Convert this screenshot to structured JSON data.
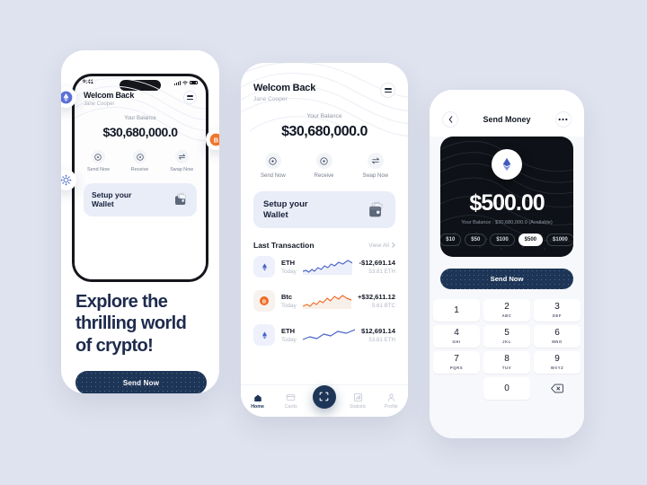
{
  "background_color": "#dfe3ef",
  "accent_navy": "#1d3557",
  "accent_blue": "#5a6fd8",
  "accent_orange": "#f0762a",
  "phone1": {
    "status_bar": {
      "time": "9:41"
    },
    "header": {
      "greeting": "Welcom Back",
      "name": "Jane Cooper",
      "menu_icon": "hamburger-icon"
    },
    "balance": {
      "label": "Your Balance",
      "amount": "$30,680,000.0"
    },
    "actions": [
      {
        "label": "Send Now",
        "icon": "send-icon"
      },
      {
        "label": "Receive",
        "icon": "receive-icon"
      },
      {
        "label": "Swap Now",
        "icon": "swap-icon"
      }
    ],
    "setup_card": {
      "line1": "Setup your",
      "line2": "Wallet",
      "icon": "wallet-icon"
    },
    "floating_icons": [
      {
        "name": "ethereum-badge",
        "symbol": "ETH",
        "color": "#5a6fd8"
      },
      {
        "name": "bitcoin-badge",
        "symbol": "BTC",
        "color": "#f0762a"
      },
      {
        "name": "network-badge",
        "symbol": "NET",
        "color": "#3f62c9"
      }
    ],
    "hero": {
      "line1": "Explore the",
      "line2": "thrilling world",
      "line3": "of crypto!"
    },
    "cta": {
      "label": "Send Now"
    }
  },
  "phone2": {
    "header": {
      "greeting": "Welcom Back",
      "name": "Jane Cooper",
      "menu_icon": "hamburger-icon"
    },
    "balance": {
      "label": "Your Balance",
      "amount": "$30,680,000.0"
    },
    "actions": [
      {
        "label": "Send Now",
        "icon": "send-icon"
      },
      {
        "label": "Receive",
        "icon": "receive-icon"
      },
      {
        "label": "Swap Now",
        "icon": "swap-icon"
      }
    ],
    "setup_card": {
      "line1": "Setup your",
      "line2": "Wallet",
      "icon": "wallet-icon"
    },
    "transactions_section": {
      "title": "Last Transaction",
      "view_all": "View All",
      "chevron": "chevron-right-icon"
    },
    "transactions": [
      {
        "symbol": "ETH",
        "icon": "ethereum-icon",
        "when": "Today",
        "amount": "-$12,691.14",
        "quantity": "53.81 ETH",
        "trend_color": "#4a63c9"
      },
      {
        "symbol": "Btc",
        "icon": "bitcoin-icon",
        "when": "Today",
        "amount": "+$32,611.12",
        "quantity": "5.61 BTC",
        "trend_color": "#ef6a23"
      },
      {
        "symbol": "ETH",
        "icon": "ethereum-icon",
        "when": "Today",
        "amount": "$12,691.14",
        "quantity": "53.81 ETH",
        "trend_color": "#4a63c9"
      }
    ],
    "tabs": [
      {
        "label": "Home",
        "icon": "home-icon",
        "active": true
      },
      {
        "label": "Cards",
        "icon": "card-icon",
        "active": false
      },
      {
        "label": "",
        "icon": "scan-icon",
        "active": false
      },
      {
        "label": "Statistic",
        "icon": "chart-icon",
        "active": false
      },
      {
        "label": "Profile",
        "icon": "person-icon",
        "active": false
      }
    ]
  },
  "phone3": {
    "header": {
      "back_icon": "chevron-left-icon",
      "title": "Send Money",
      "more_icon": "more-horizontal-icon"
    },
    "card": {
      "avatar_icon": "ethereum-icon",
      "amount": "$500.00",
      "balance_note": "Your Balance : $30,680,000.0 (Available)",
      "chips": [
        {
          "label": "$10",
          "selected": false
        },
        {
          "label": "$50",
          "selected": false
        },
        {
          "label": "$100",
          "selected": false
        },
        {
          "label": "$500",
          "selected": true
        },
        {
          "label": "$1000",
          "selected": false
        }
      ]
    },
    "send_button": {
      "label": "Send Now"
    },
    "keypad": [
      {
        "num": "1",
        "letters": ""
      },
      {
        "num": "2",
        "letters": "ABC"
      },
      {
        "num": "3",
        "letters": "DEF"
      },
      {
        "num": "4",
        "letters": "GHI"
      },
      {
        "num": "5",
        "letters": "JKL"
      },
      {
        "num": "6",
        "letters": "MNO"
      },
      {
        "num": "7",
        "letters": "PQRS"
      },
      {
        "num": "8",
        "letters": "TUV"
      },
      {
        "num": "9",
        "letters": "WXYZ"
      },
      {
        "num": "",
        "letters": ""
      },
      {
        "num": "0",
        "letters": ""
      },
      {
        "num": "",
        "letters": "delete-icon"
      }
    ]
  }
}
